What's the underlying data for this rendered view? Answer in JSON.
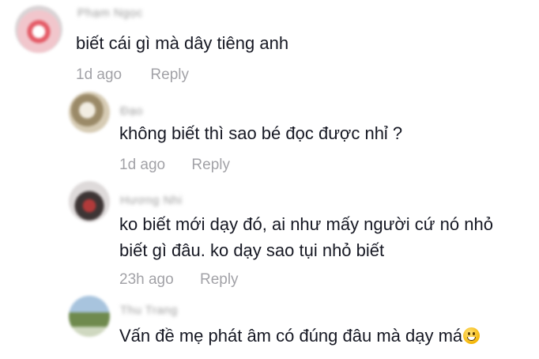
{
  "comments": [
    {
      "username": "Phạm Ngọc",
      "text": "biết cái gì mà dây tiêng anh",
      "time": "1d ago",
      "reply": "Reply",
      "avatar_colors": [
        "#f3c9cf",
        "#d94b55",
        "#ffffff"
      ]
    },
    {
      "username": "Đạo",
      "text": "không biết thì sao bé đọc được nhỉ ?",
      "time": "1d ago",
      "reply": "Reply",
      "avatar_colors": [
        "#d7ccb7",
        "#8a7a5a",
        "#f1ece0"
      ]
    },
    {
      "username": "Hương Nhi",
      "text_lines": [
        "ko biết mới dạy đó, ai như mấy người cứ nó nhỏ",
        "biết gì đâu. ko dạy sao tụi nhỏ biết"
      ],
      "time": "23h ago",
      "reply": "Reply",
      "avatar_colors": [
        "#e0dcdc",
        "#4a4040",
        "#c23d3d"
      ]
    },
    {
      "username": "Thu Trang",
      "text": "Vấn đề mẹ phát âm có đúng đâu mà dạy má",
      "emoji": "grinning-face-emoji",
      "avatar_colors": [
        "#dfe6ec",
        "#6f8a4e",
        "#9ab8d6"
      ]
    }
  ]
}
